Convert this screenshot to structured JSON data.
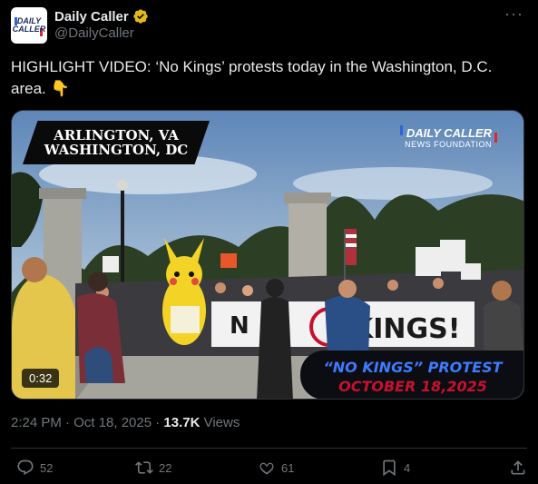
{
  "author": {
    "name": "Daily Caller",
    "handle": "@DailyCaller",
    "avatar_text_1": "DAILY",
    "avatar_text_2": "CALLER",
    "verified_color": "#e2b719"
  },
  "tweet": {
    "text": "HIGHLIGHT VIDEO: ‘No Kings’ protests today in the Washington, D.C. area. 👇"
  },
  "video": {
    "duration": "0:32",
    "overlay_location_1": "ARLINGTON, VA",
    "overlay_location_2": "WASHINGTON, DC",
    "watermark_1": "DAILY CALLER",
    "watermark_2": "NEWS FOUNDATION",
    "banner_line_1": "“NO KINGS” PROTEST",
    "banner_line_2": "OCTOBER 18,2025",
    "sign_text": "NO KINGS!"
  },
  "meta": {
    "time_date": "2:24 PM · Oct 18, 2025 · ",
    "views_count": "13.7K",
    "views_label": " Views"
  },
  "actions": {
    "replies": "52",
    "reposts": "22",
    "likes": "61",
    "bookmarks": "4"
  },
  "colors": {
    "background": "#000000",
    "text_primary": "#e7e9ea",
    "text_secondary": "#71767b",
    "divider": "#2f3336"
  }
}
